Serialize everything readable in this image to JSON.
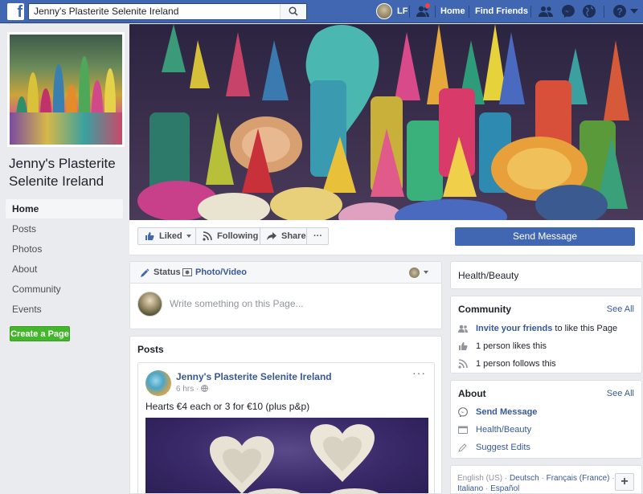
{
  "topbar": {
    "search_value": "Jenny's Plasterite Selenite Ireland",
    "user_initials": "LF",
    "home": "Home",
    "find_friends": "Find Friends",
    "colors": {
      "bar": "#4267b2",
      "badge": "#fa3e3e"
    }
  },
  "sidebar": {
    "page_name": "Jenny's Plasterite Selenite Ireland",
    "items": [
      {
        "label": "Home"
      },
      {
        "label": "Posts"
      },
      {
        "label": "Photos"
      },
      {
        "label": "About"
      },
      {
        "label": "Community"
      },
      {
        "label": "Events"
      }
    ],
    "create_page": "Create a Page"
  },
  "actions": {
    "liked": "Liked",
    "following": "Following",
    "share": "Share",
    "more": "···",
    "send_message": "Send Message"
  },
  "composer": {
    "tab_status": "Status",
    "tab_photo": "Photo/Video",
    "placeholder": "Write something on this Page..."
  },
  "posts": {
    "title": "Posts",
    "post": {
      "author": "Jenny's Plasterite Selenite Ireland",
      "time": "6 hrs",
      "text": "Hearts €4 each or 3 for €10 (plus p&p)"
    }
  },
  "right": {
    "category": "Health/Beauty",
    "community": {
      "title": "Community",
      "see_all": "See All",
      "invite_link": "Invite your friends",
      "invite_rest": " to like this Page",
      "likes": "1 person likes this",
      "follows": "1 person follows this"
    },
    "about": {
      "title": "About",
      "see_all": "See All",
      "send_message": "Send Message",
      "category": "Health/Beauty",
      "suggest_edits": "Suggest Edits"
    },
    "languages": {
      "current": "English (US)",
      "options": [
        "Deutsch",
        "Français (France)",
        "Italiano",
        "Español"
      ],
      "plus": "+"
    }
  }
}
